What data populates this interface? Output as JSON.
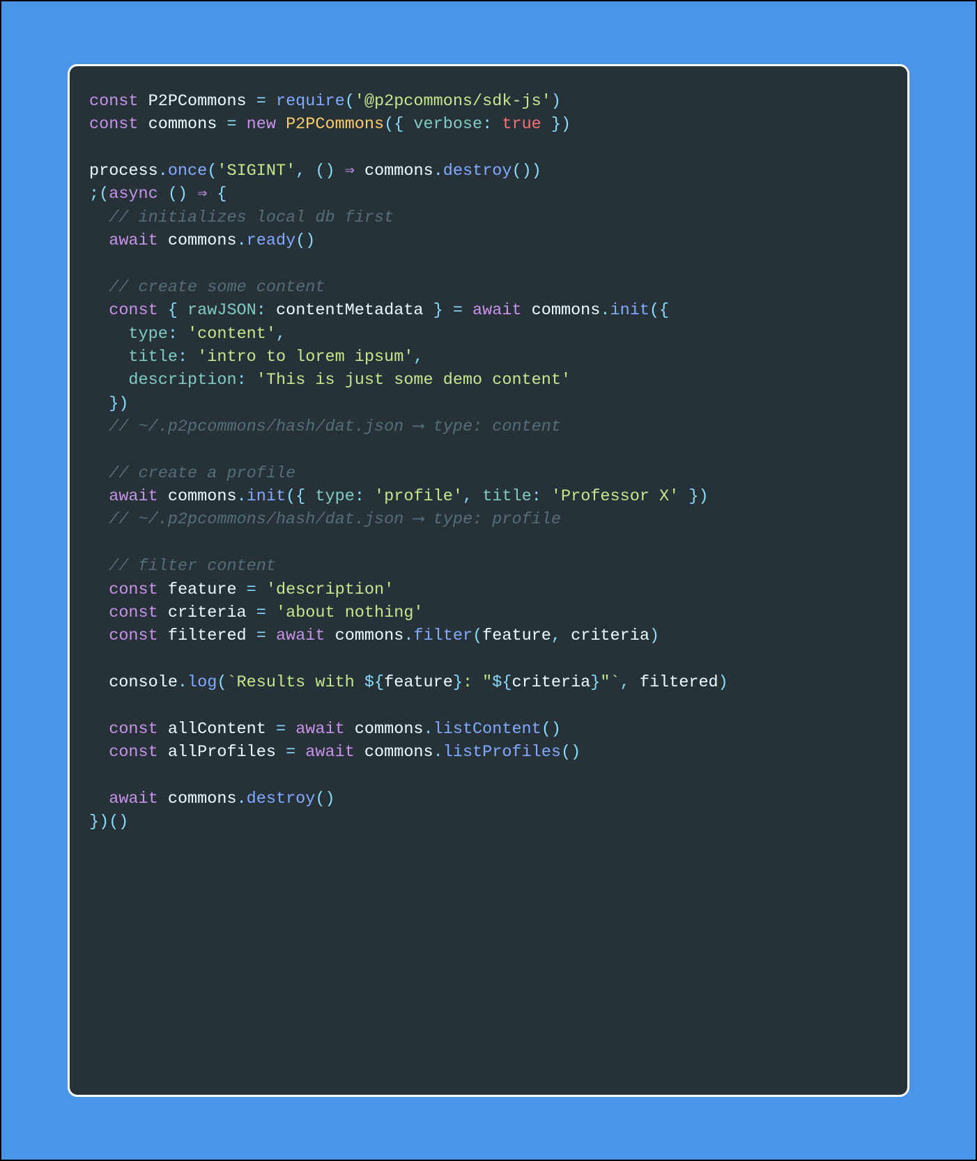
{
  "code": {
    "tokens": [
      [
        [
          "kw",
          "const"
        ],
        [
          "id",
          " P2PCommons "
        ],
        [
          "op",
          "= "
        ],
        [
          "fn",
          "require"
        ],
        [
          "op",
          "("
        ],
        [
          "str",
          "'@p2pcommons/sdk-js'"
        ],
        [
          "op",
          ")"
        ]
      ],
      [
        [
          "kw",
          "const"
        ],
        [
          "id",
          " commons "
        ],
        [
          "op",
          "= "
        ],
        [
          "kw",
          "new"
        ],
        [
          "id",
          " "
        ],
        [
          "cls",
          "P2PCommons"
        ],
        [
          "op",
          "({ "
        ],
        [
          "prop",
          "verbose"
        ],
        [
          "op",
          ": "
        ],
        [
          "bool",
          "true"
        ],
        [
          "op",
          " })"
        ]
      ],
      [],
      [
        [
          "id",
          "process"
        ],
        [
          "op",
          "."
        ],
        [
          "fn",
          "once"
        ],
        [
          "op",
          "("
        ],
        [
          "str",
          "'SIGINT'"
        ],
        [
          "op",
          ", () "
        ],
        [
          "kw",
          "⇒"
        ],
        [
          "id",
          " commons"
        ],
        [
          "op",
          "."
        ],
        [
          "fn",
          "destroy"
        ],
        [
          "op",
          "())"
        ]
      ],
      [
        [
          "op",
          ";("
        ],
        [
          "kw",
          "async"
        ],
        [
          "op",
          " () "
        ],
        [
          "kw",
          "⇒"
        ],
        [
          "op",
          " {"
        ]
      ],
      [
        [
          "id",
          "  "
        ],
        [
          "com",
          "// initializes local db first"
        ]
      ],
      [
        [
          "id",
          "  "
        ],
        [
          "kw",
          "await"
        ],
        [
          "id",
          " commons"
        ],
        [
          "op",
          "."
        ],
        [
          "fn",
          "ready"
        ],
        [
          "op",
          "()"
        ]
      ],
      [],
      [
        [
          "id",
          "  "
        ],
        [
          "com",
          "// create some content"
        ]
      ],
      [
        [
          "id",
          "  "
        ],
        [
          "kw",
          "const"
        ],
        [
          "op",
          " { "
        ],
        [
          "prop",
          "rawJSON"
        ],
        [
          "op",
          ": "
        ],
        [
          "id",
          "contentMetadata"
        ],
        [
          "op",
          " } = "
        ],
        [
          "kw",
          "await"
        ],
        [
          "id",
          " commons"
        ],
        [
          "op",
          "."
        ],
        [
          "fn",
          "init"
        ],
        [
          "op",
          "({"
        ]
      ],
      [
        [
          "id",
          "    "
        ],
        [
          "prop",
          "type"
        ],
        [
          "op",
          ": "
        ],
        [
          "str",
          "'content'"
        ],
        [
          "op",
          ","
        ]
      ],
      [
        [
          "id",
          "    "
        ],
        [
          "prop",
          "title"
        ],
        [
          "op",
          ": "
        ],
        [
          "str",
          "'intro to lorem ipsum'"
        ],
        [
          "op",
          ","
        ]
      ],
      [
        [
          "id",
          "    "
        ],
        [
          "prop",
          "description"
        ],
        [
          "op",
          ": "
        ],
        [
          "str",
          "'This is just some demo content'"
        ]
      ],
      [
        [
          "id",
          "  "
        ],
        [
          "op",
          "})"
        ]
      ],
      [
        [
          "id",
          "  "
        ],
        [
          "com",
          "// ~/.p2pcommons/hash/dat.json ⟶ type: content"
        ]
      ],
      [],
      [
        [
          "id",
          "  "
        ],
        [
          "com",
          "// create a profile"
        ]
      ],
      [
        [
          "id",
          "  "
        ],
        [
          "kw",
          "await"
        ],
        [
          "id",
          " commons"
        ],
        [
          "op",
          "."
        ],
        [
          "fn",
          "init"
        ],
        [
          "op",
          "({ "
        ],
        [
          "prop",
          "type"
        ],
        [
          "op",
          ": "
        ],
        [
          "str",
          "'profile'"
        ],
        [
          "op",
          ", "
        ],
        [
          "prop",
          "title"
        ],
        [
          "op",
          ": "
        ],
        [
          "str",
          "'Professor X'"
        ],
        [
          "op",
          " })"
        ]
      ],
      [
        [
          "id",
          "  "
        ],
        [
          "com",
          "// ~/.p2pcommons/hash/dat.json ⟶ type: profile"
        ]
      ],
      [],
      [
        [
          "id",
          "  "
        ],
        [
          "com",
          "// filter content"
        ]
      ],
      [
        [
          "id",
          "  "
        ],
        [
          "kw",
          "const"
        ],
        [
          "id",
          " feature "
        ],
        [
          "op",
          "= "
        ],
        [
          "str",
          "'description'"
        ]
      ],
      [
        [
          "id",
          "  "
        ],
        [
          "kw",
          "const"
        ],
        [
          "id",
          " criteria "
        ],
        [
          "op",
          "= "
        ],
        [
          "str",
          "'about nothing'"
        ]
      ],
      [
        [
          "id",
          "  "
        ],
        [
          "kw",
          "const"
        ],
        [
          "id",
          " filtered "
        ],
        [
          "op",
          "= "
        ],
        [
          "kw",
          "await"
        ],
        [
          "id",
          " commons"
        ],
        [
          "op",
          "."
        ],
        [
          "fn",
          "filter"
        ],
        [
          "op",
          "("
        ],
        [
          "id",
          "feature"
        ],
        [
          "op",
          ", "
        ],
        [
          "id",
          "criteria"
        ],
        [
          "op",
          ")"
        ]
      ],
      [],
      [
        [
          "id",
          "  console"
        ],
        [
          "op",
          "."
        ],
        [
          "fn",
          "log"
        ],
        [
          "op",
          "("
        ],
        [
          "str",
          "`Results with "
        ],
        [
          "op",
          "${"
        ],
        [
          "id",
          "feature"
        ],
        [
          "op",
          "}"
        ],
        [
          "str",
          ": \""
        ],
        [
          "op",
          "${"
        ],
        [
          "id",
          "criteria"
        ],
        [
          "op",
          "}"
        ],
        [
          "str",
          "\"`"
        ],
        [
          "op",
          ", "
        ],
        [
          "id",
          "filtered"
        ],
        [
          "op",
          ")"
        ]
      ],
      [],
      [
        [
          "id",
          "  "
        ],
        [
          "kw",
          "const"
        ],
        [
          "id",
          " allContent "
        ],
        [
          "op",
          "= "
        ],
        [
          "kw",
          "await"
        ],
        [
          "id",
          " commons"
        ],
        [
          "op",
          "."
        ],
        [
          "fn",
          "listContent"
        ],
        [
          "op",
          "()"
        ]
      ],
      [
        [
          "id",
          "  "
        ],
        [
          "kw",
          "const"
        ],
        [
          "id",
          " allProfiles "
        ],
        [
          "op",
          "= "
        ],
        [
          "kw",
          "await"
        ],
        [
          "id",
          " commons"
        ],
        [
          "op",
          "."
        ],
        [
          "fn",
          "listProfiles"
        ],
        [
          "op",
          "()"
        ]
      ],
      [],
      [
        [
          "id",
          "  "
        ],
        [
          "kw",
          "await"
        ],
        [
          "id",
          " commons"
        ],
        [
          "op",
          "."
        ],
        [
          "fn",
          "destroy"
        ],
        [
          "op",
          "()"
        ]
      ],
      [
        [
          "op",
          "})()"
        ]
      ]
    ]
  }
}
